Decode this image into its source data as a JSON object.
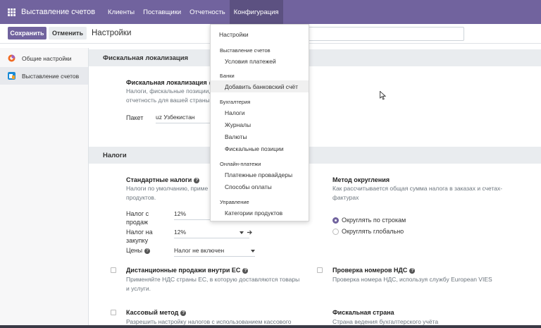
{
  "topbar": {
    "app_name": "Выставление счетов",
    "menu": [
      "Клиенты",
      "Поставщики",
      "Отчетность",
      "Конфигурация"
    ]
  },
  "controlbar": {
    "save_label": "Сохранить",
    "cancel_label": "Отменить",
    "title": "Настройки"
  },
  "sidebar": {
    "items": [
      {
        "label": "Общие настройки"
      },
      {
        "label": "Выставление счетов"
      }
    ]
  },
  "sections": {
    "fiscal": {
      "header": "Фискальная локализация",
      "setting_title": "Фискальная локализация",
      "desc_line1": "Налоги, фискальные позиции,",
      "desc_line2": "отчетность для вашей страны",
      "package_label": "Пакет",
      "package_value": "uz Узбекистан"
    },
    "taxes": {
      "header": "Налоги",
      "default_taxes_title": "Стандартные налоги",
      "default_taxes_desc1": "Налоги по умолчанию, приме",
      "default_taxes_desc2": "продуктов.",
      "sales_label1": "Налог с",
      "sales_label2": "продаж",
      "sales_value": "12%",
      "purchase_label1": "Налог на",
      "purchase_label2": "закупку",
      "purchase_value": "12%",
      "prices_label": "Цены",
      "prices_value": "Налог не включен",
      "rounding_title": "Метод округления",
      "rounding_desc1": "Как рассчитывается общая сумма налога в заказах и счетах-",
      "rounding_desc2": "фактурах",
      "rounding_option1": "Округлять по строкам",
      "rounding_option2": "Округлять глобально",
      "eu_title": "Дистанционные продажи внутри ЕС",
      "eu_desc1": "Применяйте НДС страны ЕС, в которую доставляются товары",
      "eu_desc2": "и услуги.",
      "vat_title": "Проверка номеров НДС",
      "vat_desc": "Проверка номера НДС, используя службу European VIES",
      "cash_title": "Кассовый метод",
      "cash_desc": "Разрешить настройку налогов с использованием кассового",
      "country_title": "Фискальная страна",
      "country_desc": "Страна ведения бухгалтерского учёта"
    }
  },
  "dropdown": {
    "settings": "Настройки",
    "group_invoicing": "Выставление счетов",
    "payment_terms": "Условия платежей",
    "group_banks": "Банки",
    "add_bank": "Добавить банковский счёт",
    "group_accounting": "Бухгалтерия",
    "taxes": "Налоги",
    "journals": "Журналы",
    "currencies": "Валюты",
    "fiscal_positions": "Фискальные позиции",
    "group_online": "Онлайн-платежи",
    "payment_providers": "Платежные провайдеры",
    "payment_methods": "Способы оплаты",
    "group_management": "Управление",
    "product_categories": "Категории продуктов"
  },
  "colors": {
    "brand": "#71639e",
    "section_bg": "#e9ecef"
  }
}
